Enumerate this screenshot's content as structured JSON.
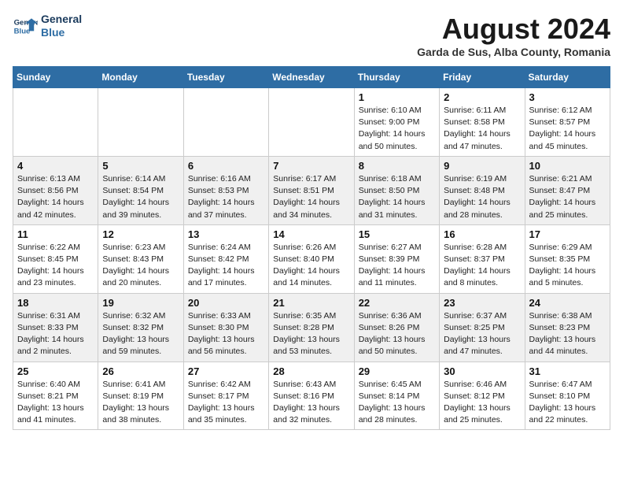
{
  "header": {
    "logo_line1": "General",
    "logo_line2": "Blue",
    "month_year": "August 2024",
    "location": "Garda de Sus, Alba County, Romania"
  },
  "days_of_week": [
    "Sunday",
    "Monday",
    "Tuesday",
    "Wednesday",
    "Thursday",
    "Friday",
    "Saturday"
  ],
  "weeks": [
    [
      {
        "day": "",
        "info": ""
      },
      {
        "day": "",
        "info": ""
      },
      {
        "day": "",
        "info": ""
      },
      {
        "day": "",
        "info": ""
      },
      {
        "day": "1",
        "info": "Sunrise: 6:10 AM\nSunset: 9:00 PM\nDaylight: 14 hours\nand 50 minutes."
      },
      {
        "day": "2",
        "info": "Sunrise: 6:11 AM\nSunset: 8:58 PM\nDaylight: 14 hours\nand 47 minutes."
      },
      {
        "day": "3",
        "info": "Sunrise: 6:12 AM\nSunset: 8:57 PM\nDaylight: 14 hours\nand 45 minutes."
      }
    ],
    [
      {
        "day": "4",
        "info": "Sunrise: 6:13 AM\nSunset: 8:56 PM\nDaylight: 14 hours\nand 42 minutes."
      },
      {
        "day": "5",
        "info": "Sunrise: 6:14 AM\nSunset: 8:54 PM\nDaylight: 14 hours\nand 39 minutes."
      },
      {
        "day": "6",
        "info": "Sunrise: 6:16 AM\nSunset: 8:53 PM\nDaylight: 14 hours\nand 37 minutes."
      },
      {
        "day": "7",
        "info": "Sunrise: 6:17 AM\nSunset: 8:51 PM\nDaylight: 14 hours\nand 34 minutes."
      },
      {
        "day": "8",
        "info": "Sunrise: 6:18 AM\nSunset: 8:50 PM\nDaylight: 14 hours\nand 31 minutes."
      },
      {
        "day": "9",
        "info": "Sunrise: 6:19 AM\nSunset: 8:48 PM\nDaylight: 14 hours\nand 28 minutes."
      },
      {
        "day": "10",
        "info": "Sunrise: 6:21 AM\nSunset: 8:47 PM\nDaylight: 14 hours\nand 25 minutes."
      }
    ],
    [
      {
        "day": "11",
        "info": "Sunrise: 6:22 AM\nSunset: 8:45 PM\nDaylight: 14 hours\nand 23 minutes."
      },
      {
        "day": "12",
        "info": "Sunrise: 6:23 AM\nSunset: 8:43 PM\nDaylight: 14 hours\nand 20 minutes."
      },
      {
        "day": "13",
        "info": "Sunrise: 6:24 AM\nSunset: 8:42 PM\nDaylight: 14 hours\nand 17 minutes."
      },
      {
        "day": "14",
        "info": "Sunrise: 6:26 AM\nSunset: 8:40 PM\nDaylight: 14 hours\nand 14 minutes."
      },
      {
        "day": "15",
        "info": "Sunrise: 6:27 AM\nSunset: 8:39 PM\nDaylight: 14 hours\nand 11 minutes."
      },
      {
        "day": "16",
        "info": "Sunrise: 6:28 AM\nSunset: 8:37 PM\nDaylight: 14 hours\nand 8 minutes."
      },
      {
        "day": "17",
        "info": "Sunrise: 6:29 AM\nSunset: 8:35 PM\nDaylight: 14 hours\nand 5 minutes."
      }
    ],
    [
      {
        "day": "18",
        "info": "Sunrise: 6:31 AM\nSunset: 8:33 PM\nDaylight: 14 hours\nand 2 minutes."
      },
      {
        "day": "19",
        "info": "Sunrise: 6:32 AM\nSunset: 8:32 PM\nDaylight: 13 hours\nand 59 minutes."
      },
      {
        "day": "20",
        "info": "Sunrise: 6:33 AM\nSunset: 8:30 PM\nDaylight: 13 hours\nand 56 minutes."
      },
      {
        "day": "21",
        "info": "Sunrise: 6:35 AM\nSunset: 8:28 PM\nDaylight: 13 hours\nand 53 minutes."
      },
      {
        "day": "22",
        "info": "Sunrise: 6:36 AM\nSunset: 8:26 PM\nDaylight: 13 hours\nand 50 minutes."
      },
      {
        "day": "23",
        "info": "Sunrise: 6:37 AM\nSunset: 8:25 PM\nDaylight: 13 hours\nand 47 minutes."
      },
      {
        "day": "24",
        "info": "Sunrise: 6:38 AM\nSunset: 8:23 PM\nDaylight: 13 hours\nand 44 minutes."
      }
    ],
    [
      {
        "day": "25",
        "info": "Sunrise: 6:40 AM\nSunset: 8:21 PM\nDaylight: 13 hours\nand 41 minutes."
      },
      {
        "day": "26",
        "info": "Sunrise: 6:41 AM\nSunset: 8:19 PM\nDaylight: 13 hours\nand 38 minutes."
      },
      {
        "day": "27",
        "info": "Sunrise: 6:42 AM\nSunset: 8:17 PM\nDaylight: 13 hours\nand 35 minutes."
      },
      {
        "day": "28",
        "info": "Sunrise: 6:43 AM\nSunset: 8:16 PM\nDaylight: 13 hours\nand 32 minutes."
      },
      {
        "day": "29",
        "info": "Sunrise: 6:45 AM\nSunset: 8:14 PM\nDaylight: 13 hours\nand 28 minutes."
      },
      {
        "day": "30",
        "info": "Sunrise: 6:46 AM\nSunset: 8:12 PM\nDaylight: 13 hours\nand 25 minutes."
      },
      {
        "day": "31",
        "info": "Sunrise: 6:47 AM\nSunset: 8:10 PM\nDaylight: 13 hours\nand 22 minutes."
      }
    ]
  ]
}
